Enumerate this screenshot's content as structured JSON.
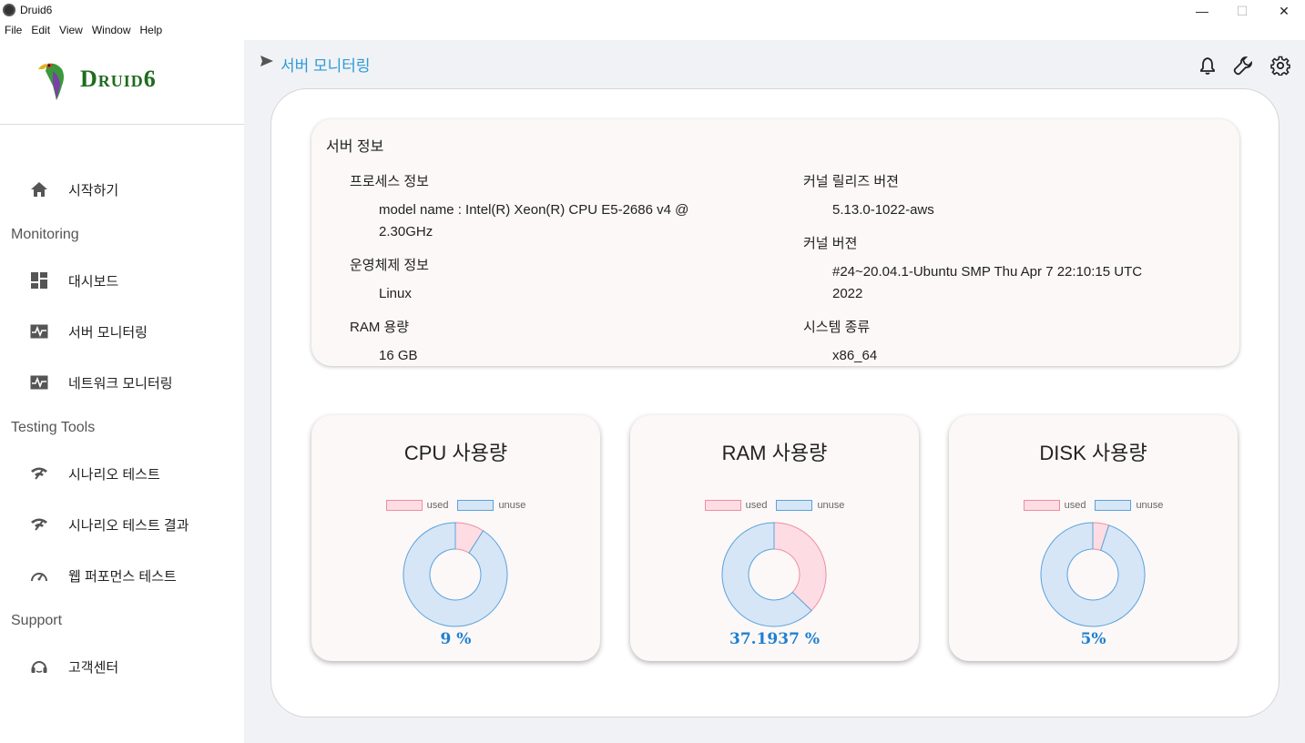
{
  "window": {
    "title": "Druid6",
    "minimize": "—",
    "maximize": "☐",
    "close": "✕"
  },
  "menu": [
    "File",
    "Edit",
    "View",
    "Window",
    "Help"
  ],
  "sidebar": {
    "logo_text": "Druid6",
    "items": [
      {
        "label": "시작하기",
        "icon": "home-icon"
      },
      {
        "label": "대시보드",
        "icon": "dashboard-icon"
      },
      {
        "label": "서버 모니터링",
        "icon": "monitor-pulse-icon"
      },
      {
        "label": "네트워크 모니터링",
        "icon": "monitor-pulse-icon"
      },
      {
        "label": "시나리오 테스트",
        "icon": "signal-icon"
      },
      {
        "label": "시나리오 테스트 결과",
        "icon": "signal-icon"
      },
      {
        "label": "웹 퍼포먼스 테스트",
        "icon": "speedometer-icon"
      },
      {
        "label": "고객센터",
        "icon": "headset-icon"
      }
    ],
    "sections": [
      "Monitoring",
      "Testing Tools",
      "Support"
    ]
  },
  "header": {
    "title": "서버 모니터링",
    "icons": [
      "bell-icon",
      "wrench-icon",
      "gear-icon"
    ]
  },
  "server_info": {
    "title": "서버 정보",
    "process_label": "프로세스 정보",
    "process_value_1": "model name : Intel(R) Xeon(R) CPU E5-2686 v4 @",
    "process_value_2": "2.30GHz",
    "os_label": "운영체제 정보",
    "os_value": "Linux",
    "ram_label": "RAM 용량",
    "ram_value": "16 GB",
    "kernel_release_label": "커널 릴리즈 버젼",
    "kernel_release_value": "5.13.0-1022-aws",
    "kernel_version_label": "커널 버젼",
    "kernel_version_value_1": "#24~20.04.1-Ubuntu SMP Thu Apr 7 22:10:15 UTC",
    "kernel_version_value_2": "2022",
    "system_type_label": "시스템 종류",
    "system_type_value": "x86_64"
  },
  "legend": {
    "used": "used",
    "unuse": "unuse"
  },
  "colors": {
    "used": "#fddde3",
    "used_border": "#f08ca2",
    "unuse": "#d6e6f6",
    "unuse_border": "#5aa2dd",
    "accent": "#2b9bd6"
  },
  "chart_data": [
    {
      "type": "pie",
      "title": "CPU 사용량",
      "categories": [
        "used",
        "unuse"
      ],
      "values": [
        9,
        91
      ],
      "label": "9 %"
    },
    {
      "type": "pie",
      "title": "RAM 사용량",
      "categories": [
        "used",
        "unuse"
      ],
      "values": [
        37.1937,
        62.8063
      ],
      "label": "37.1937 %"
    },
    {
      "type": "pie",
      "title": "DISK 사용량",
      "categories": [
        "used",
        "unuse"
      ],
      "values": [
        5,
        95
      ],
      "label": "5%"
    }
  ]
}
